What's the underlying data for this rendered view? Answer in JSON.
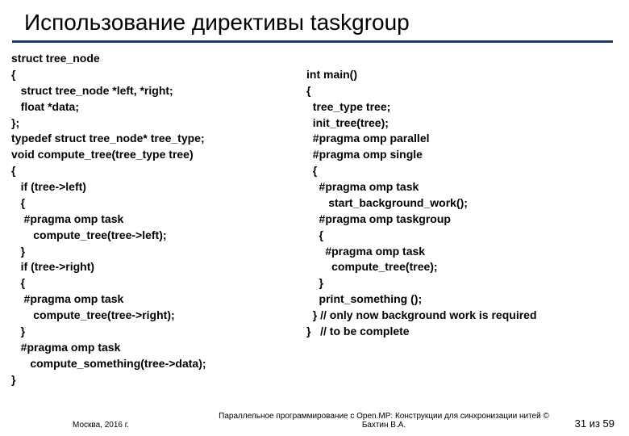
{
  "title": "Использование директивы taskgroup",
  "code_left": "struct tree_node\n{\n   struct tree_node *left, *right;\n   float *data;\n};\ntypedef struct tree_node* tree_type;\nvoid compute_tree(tree_type tree)\n{\n   if (tree->left)\n   {\n    #pragma omp task\n       compute_tree(tree->left);\n   }\n   if (tree->right)\n   {\n    #pragma omp task\n       compute_tree(tree->right);\n   }\n   #pragma omp task\n      compute_something(tree->data);\n}",
  "code_right": "\nint main()\n{\n  tree_type tree;\n  init_tree(tree);\n  #pragma omp parallel\n  #pragma omp single\n  {\n    #pragma omp task\n       start_background_work();\n    #pragma omp taskgroup\n    {\n      #pragma omp task\n        compute_tree(tree);\n    }\n    print_something ();\n  } // only now background work is required\n}   // to be complete",
  "footer": {
    "left": "Москва, 2016 г.",
    "center": "Параллельное программирование с Open.MP: Конструкции для синхронизации нитей © Бахтин В.А.",
    "right": "31 из 59"
  }
}
